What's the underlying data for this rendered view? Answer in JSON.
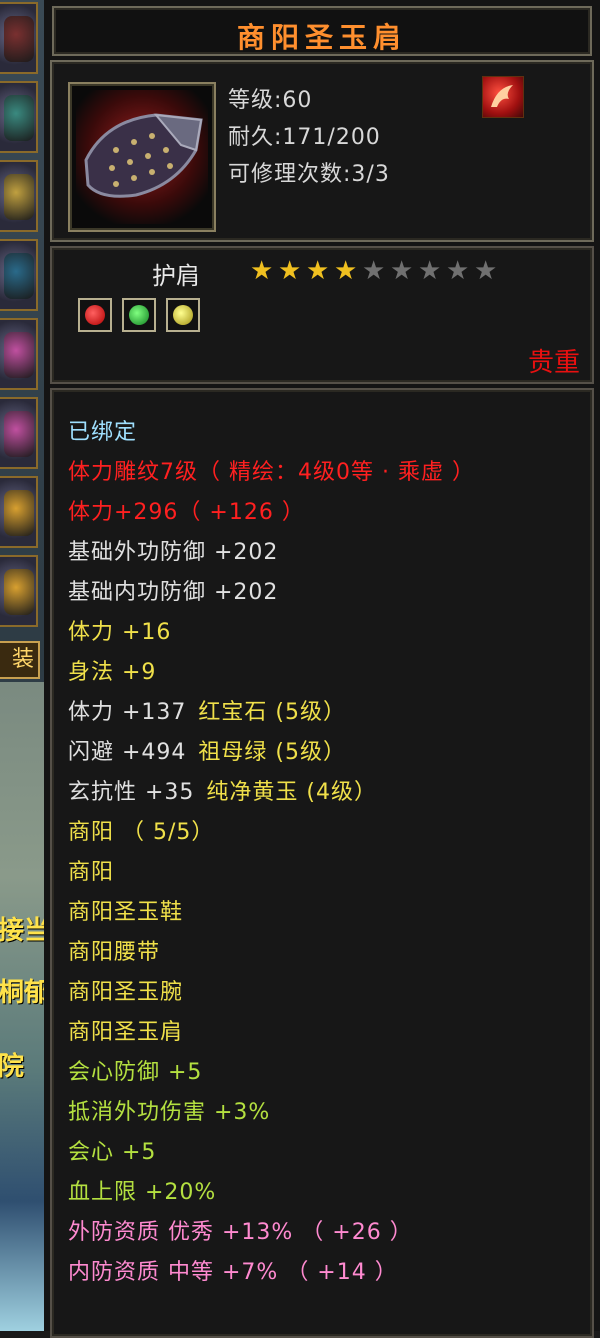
{
  "colors": {
    "title": "#ff8f2e",
    "stat_text": "#d8d8d8",
    "bound": "#9fe0ff",
    "red": "#ff2020",
    "white": "#e0e0e0",
    "yellow": "#f0e04a",
    "green": "#b4e040",
    "pink": "#ff8ad0",
    "rarity": "#e81010",
    "star_on": "#f0c020",
    "star_off": "#707070"
  },
  "item": {
    "name": "商阳圣玉肩",
    "level": "等级:60",
    "durability": "耐久:171/200",
    "repair_count": "可修理次数:3/3",
    "type": "护肩",
    "stars_filled": 4,
    "stars_total": 9,
    "rarity": "贵重",
    "gems": [
      "red-gem",
      "green-gem",
      "yellow-gem"
    ]
  },
  "attributes": [
    {
      "text": "已绑定",
      "color": "bound"
    },
    {
      "text": "体力雕纹7级（ 精绘：4级0等 · 乘虚 ）",
      "color": "red"
    },
    {
      "text": "体力+296（ +126 ）",
      "color": "red"
    },
    {
      "text": "基础外功防御 +202",
      "color": "white"
    },
    {
      "text": "基础内功防御 +202",
      "color": "white"
    },
    {
      "text": "体力 +16",
      "color": "yellow"
    },
    {
      "text": "身法 +9",
      "color": "yellow"
    },
    {
      "text": "体力 +137",
      "extra": "红宝石 (5级）",
      "color": "white",
      "extra_color": "yellow"
    },
    {
      "text": "闪避 +494",
      "extra": "祖母绿 (5级）",
      "color": "white",
      "extra_color": "yellow"
    },
    {
      "text": "玄抗性 +35",
      "extra": "纯净黄玉 (4级）",
      "color": "white",
      "extra_color": "yellow"
    },
    {
      "text": "商阳 （ 5/5）",
      "color": "yellow"
    },
    {
      "text": "商阳",
      "color": "yellow"
    },
    {
      "text": "商阳圣玉鞋",
      "color": "yellow"
    },
    {
      "text": "商阳腰带",
      "color": "yellow"
    },
    {
      "text": "商阳圣玉腕",
      "color": "yellow"
    },
    {
      "text": "商阳圣玉肩",
      "color": "yellow"
    },
    {
      "text": "会心防御 +5",
      "color": "green"
    },
    {
      "text": "抵消外功伤害 +3%",
      "color": "green"
    },
    {
      "text": "会心 +5",
      "color": "green"
    },
    {
      "text": "血上限 +20%",
      "color": "green"
    },
    {
      "text": "外防资质   优秀 +13% （ +26 ）",
      "color": "pink"
    },
    {
      "text": "内防资质   中等 +7% （ +14 ）",
      "color": "pink"
    }
  ],
  "sidebar": {
    "tab_label": "装备",
    "scene_labels": [
      "接当",
      "桐郁",
      "院"
    ],
    "slots": [
      "armor-icon",
      "robe-icon",
      "necklace-icon",
      "helmet-icon",
      "flower-icon",
      "flower-icon",
      "shield-icon",
      "shield-icon"
    ]
  }
}
